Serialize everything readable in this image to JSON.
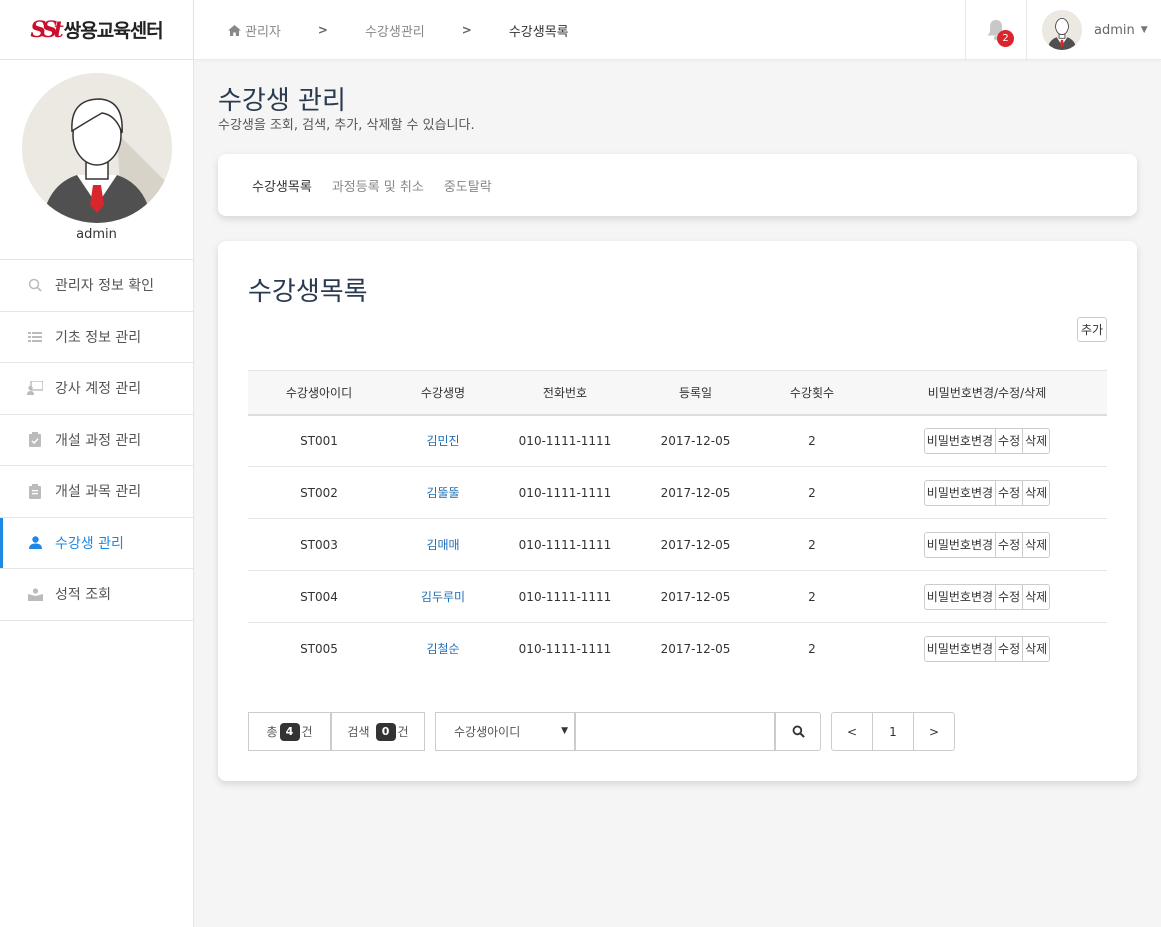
{
  "brand": {
    "mark": "SSt",
    "name": "쌍용교육센터"
  },
  "profile": {
    "name": "admin"
  },
  "sidebar": {
    "items": [
      {
        "label": "관리자 정보 확인",
        "icon": "search-icon"
      },
      {
        "label": "기초 정보 관리",
        "icon": "list-icon"
      },
      {
        "label": "강사 계정 관리",
        "icon": "teacher-icon"
      },
      {
        "label": "개설 과정 관리",
        "icon": "clipboard-check-icon"
      },
      {
        "label": "개설 과목 관리",
        "icon": "clipboard-icon"
      },
      {
        "label": "수강생 관리",
        "icon": "user-icon",
        "active": true
      },
      {
        "label": "성적 조회",
        "icon": "grade-icon"
      }
    ]
  },
  "topbar": {
    "breadcrumb": [
      "관리자",
      "수강생관리",
      "수강생목록"
    ],
    "notifications": "2",
    "user": "admin"
  },
  "page": {
    "title": "수강생 관리",
    "subtitle": "수강생을 조회, 검색, 추가, 삭제할 수 있습니다."
  },
  "tabs": [
    "수강생목록",
    "과정등록 및 취소",
    "중도탈락"
  ],
  "list": {
    "title": "수강생목록",
    "add_label": "추가",
    "columns": [
      "수강생아이디",
      "수강생명",
      "전화번호",
      "등록일",
      "수강횟수",
      "비밀번호변경/수정/삭제"
    ],
    "actions": [
      "비밀번호변경",
      "수정",
      "삭제"
    ],
    "rows": [
      {
        "id": "ST001",
        "name": "김민진",
        "phone": "010-1111-1111",
        "date": "2017-12-05",
        "count": "2"
      },
      {
        "id": "ST002",
        "name": "김뚤뚤",
        "phone": "010-1111-1111",
        "date": "2017-12-05",
        "count": "2"
      },
      {
        "id": "ST003",
        "name": "김매매",
        "phone": "010-1111-1111",
        "date": "2017-12-05",
        "count": "2"
      },
      {
        "id": "ST004",
        "name": "김두루미",
        "phone": "010-1111-1111",
        "date": "2017-12-05",
        "count": "2"
      },
      {
        "id": "ST005",
        "name": "김철순",
        "phone": "010-1111-1111",
        "date": "2017-12-05",
        "count": "2"
      }
    ]
  },
  "footer": {
    "total_prefix": "총",
    "total_count": "4",
    "total_suffix": "건",
    "search_prefix": "검색",
    "search_count": "0",
    "search_suffix": "건",
    "search_field": "수강생아이디",
    "search_value": "",
    "pager": [
      "<",
      "1",
      ">"
    ]
  },
  "colors": {
    "accent": "#1e88e5",
    "badge": "#d9262c",
    "title": "#2a3a4f"
  }
}
